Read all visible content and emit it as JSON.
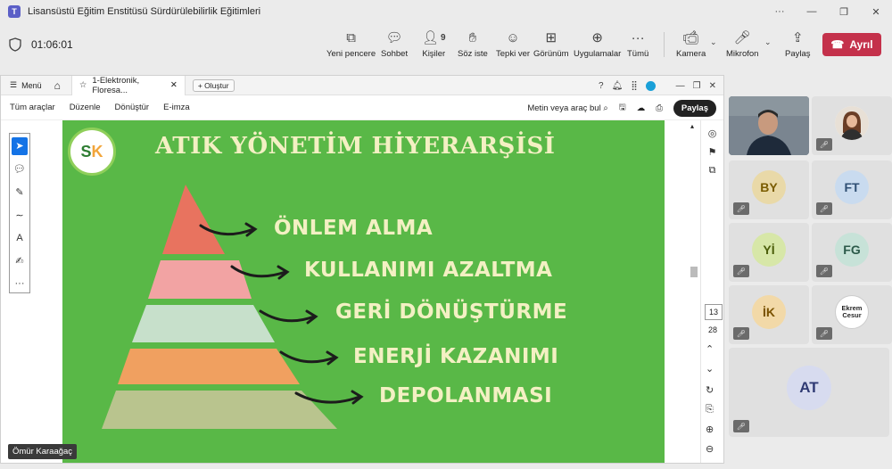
{
  "window": {
    "title": "Lisansüstü Eğitim Enstitüsü Sürdürülebilirlik Eğitimleri"
  },
  "meeting": {
    "timer": "01:06:01",
    "tools": [
      {
        "label": "Yeni pencere",
        "icon": "new-window-icon"
      },
      {
        "label": "Sohbet",
        "icon": "chat-icon"
      },
      {
        "label": "Kişiler",
        "icon": "people-icon",
        "count": "9"
      },
      {
        "label": "Söz iste",
        "icon": "raise-hand-icon"
      },
      {
        "label": "Tepki ver",
        "icon": "reaction-icon"
      },
      {
        "label": "Görünüm",
        "icon": "view-icon"
      },
      {
        "label": "Uygulamalar",
        "icon": "apps-icon"
      },
      {
        "label": "Tümü",
        "icon": "more-icon"
      }
    ],
    "camera_label": "Kamera",
    "mic_label": "Mikrofon",
    "share_label": "Paylaş",
    "leave_label": "Ayrıl"
  },
  "acrobat": {
    "menu_label": "Menü",
    "tab_title": "1-Elektronik, Floresa...",
    "new_tab_label": "Oluştur",
    "menus": [
      "Tüm araçlar",
      "Düzenle",
      "Dönüştür",
      "E-imza"
    ],
    "search_label": "Metin veya araç bul",
    "share_label": "Paylaş",
    "page_current": "13",
    "page_total": "28"
  },
  "slide": {
    "logo_text_s": "S",
    "logo_text_k": "K",
    "title": "ATIK YÖNETİM HİYERARŞİSİ",
    "steps": [
      "ÖNLEM ALMA",
      "KULLANIMI AZALTMA",
      "GERİ DÖNÜŞTÜRME",
      "ENERJİ KAZANIMI",
      "DEPOLANMASI"
    ],
    "colors": [
      "#e8735f",
      "#f2a3a3",
      "#c7e0cb",
      "#f0a060",
      "#b9c48e"
    ]
  },
  "presenter": "Ömür Karaağaç",
  "participants": [
    {
      "initials": "BY",
      "color": "#e9d9a8",
      "text_color": "#7a5c00"
    },
    {
      "initials": "FT",
      "color": "#c9dbef",
      "text_color": "#2f4f73"
    },
    {
      "initials": "Yİ",
      "color": "#d7e7a8",
      "text_color": "#4b5e0a"
    },
    {
      "initials": "FG",
      "color": "#c7e2d8",
      "text_color": "#2c5a4a"
    },
    {
      "initials": "İK",
      "color": "#f2d9a8",
      "text_color": "#7a5200"
    },
    {
      "initials": "AT",
      "color": "#d7dbef",
      "text_color": "#2f3a73"
    }
  ],
  "ekrem_photo": {
    "line1": "Ekrem",
    "line2": "Cesur"
  }
}
